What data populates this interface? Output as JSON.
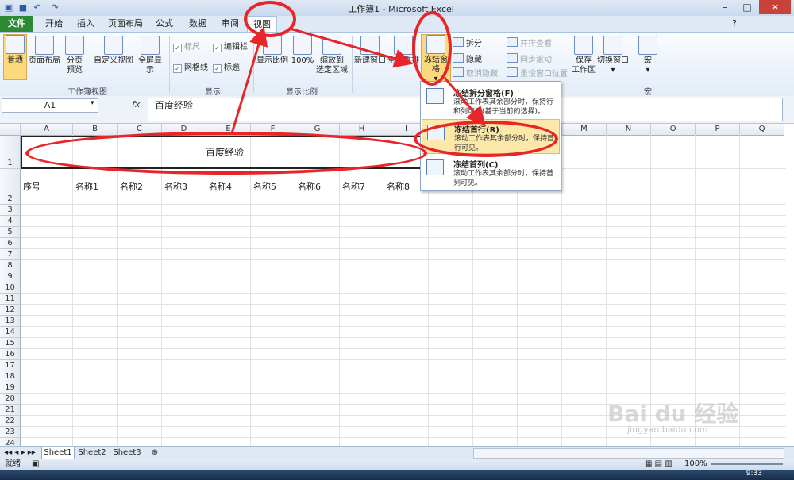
{
  "title_bar": {
    "title": "工作簿1 - Microsoft Excel"
  },
  "tabs": [
    {
      "label": "文件"
    },
    {
      "label": "开始"
    },
    {
      "label": "插入"
    },
    {
      "label": "页面布局"
    },
    {
      "label": "公式"
    },
    {
      "label": "数据"
    },
    {
      "label": "审阅"
    },
    {
      "label": "视图"
    }
  ],
  "ribbon": {
    "workbook_views": {
      "group": "工作簿视图",
      "normal": "普通",
      "page_layout": "页面布局",
      "page_break_1": "分页",
      "page_break_2": "预览",
      "custom_view": "自定义视图",
      "full_screen": "全屏显示"
    },
    "show": {
      "group": "显示",
      "ruler": "标尺",
      "gridlines": "网格线",
      "formula_bar": "编辑栏",
      "headings": "标题"
    },
    "zoom": {
      "group": "显示比例",
      "zoom": "显示比例",
      "zoom_100": "100%",
      "zoom_sel_1": "缩放到",
      "zoom_sel_2": "选定区域"
    },
    "window": {
      "new_window": "新建窗口",
      "arrange_all": "全部重排",
      "freeze": "冻结窗格",
      "split": "拆分",
      "hide": "隐藏",
      "unhide": "取消隐藏",
      "side_by_side": "并排查看",
      "sync_scroll": "同步滚动",
      "reset_pos": "重设窗口位置",
      "save_ws_1": "保存",
      "save_ws_2": "工作区",
      "switch_windows": "切换窗口"
    },
    "macros": {
      "group": "宏",
      "macros": "宏"
    }
  },
  "formula_bar": {
    "name_box": "A1",
    "fx": "fx",
    "content": "百度经验"
  },
  "columns": [
    "A",
    "B",
    "C",
    "D",
    "E",
    "F",
    "G",
    "H",
    "I",
    "J",
    "K",
    "L",
    "M",
    "N",
    "O",
    "P",
    "Q"
  ],
  "rows": [
    "1",
    "2",
    "3",
    "4",
    "5",
    "6",
    "7",
    "8",
    "9",
    "10",
    "11",
    "12",
    "13",
    "14",
    "15",
    "16",
    "17",
    "18",
    "19",
    "20",
    "21",
    "22",
    "23",
    "24"
  ],
  "cells": {
    "title": "百度经验",
    "row2": [
      "序号",
      "名称1",
      "名称2",
      "名称3",
      "名称4",
      "名称5",
      "名称6",
      "名称7",
      "名称8"
    ]
  },
  "freeze_menu": [
    {
      "title": "冻结拆分窗格(F)",
      "desc": "滚动工作表其余部分时，保持行和列可见(基于当前的选择)。"
    },
    {
      "title": "冻结首行(R)",
      "desc": "滚动工作表其余部分时，保持首行可见。"
    },
    {
      "title": "冻结首列(C)",
      "desc": "滚动工作表其余部分时，保持首列可见。"
    }
  ],
  "sheets": [
    "Sheet1",
    "Sheet2",
    "Sheet3"
  ],
  "status": {
    "ready": "就绪",
    "zoom": "100%"
  },
  "watermark": {
    "brand": "Bai du 经验",
    "url": "jingyan.baidu.com"
  },
  "taskbar": {
    "time": "9:33"
  },
  "colors": {
    "file_tab": "#2c8a33",
    "annotation": "#e8262a",
    "highlight": "#fce8a8"
  }
}
